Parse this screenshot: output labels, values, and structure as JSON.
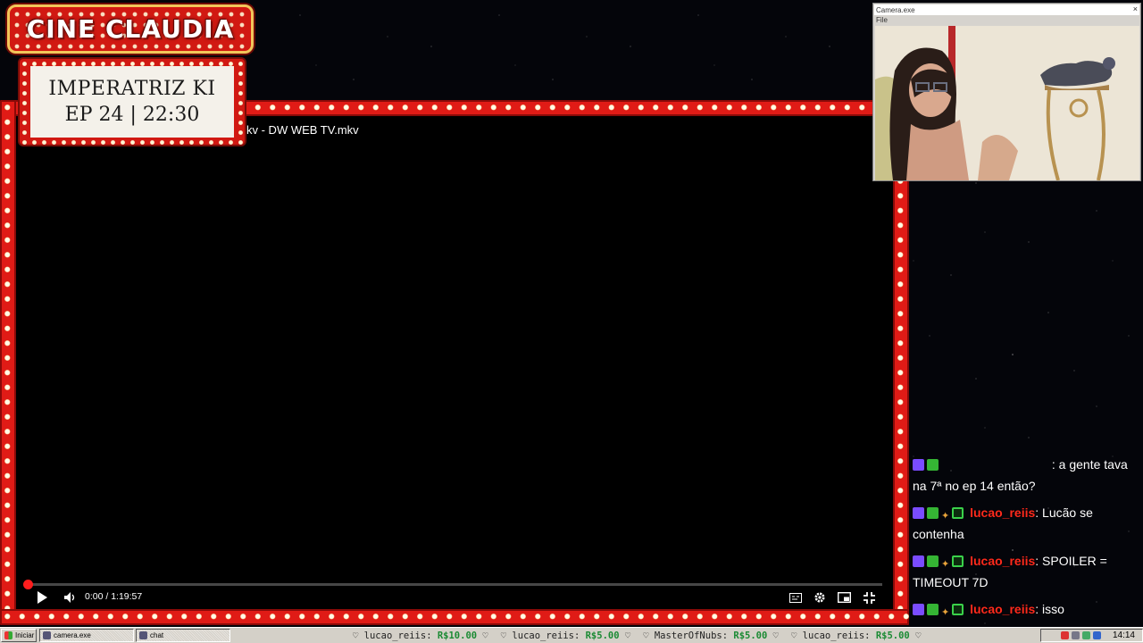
{
  "logo": {
    "text": "CINE CLAUDIA"
  },
  "sign": {
    "line1": "IMPERATRIZ KI",
    "line2": "EP 24 | 22:30"
  },
  "video": {
    "title": "kv - DW WEB TV.mkv",
    "time": "0:00 / 1:19:57",
    "progress": 0.0
  },
  "camera_window": {
    "title": "Camera.exe",
    "menu": "File",
    "close": "×"
  },
  "chat": [
    {
      "user": "",
      "text": ": a gente tava na 7ª no ep 14 então?"
    },
    {
      "user": "lucao_reiis",
      "text": ": Lucão se contenha"
    },
    {
      "user": "lucao_reiis",
      "text": ": SPOILER = TIMEOUT 7D"
    },
    {
      "user": "lucao_reiis",
      "text": ": isso"
    }
  ],
  "taskbar": {
    "start": "Iniciar",
    "buttons": [
      "camera.exe",
      "chat"
    ],
    "ticker": [
      {
        "user": "lucao_reiis:",
        "amount": "R$10.00"
      },
      {
        "user": "lucao_reiis:",
        "amount": "R$5.00"
      },
      {
        "user": "MasterOfNubs:",
        "amount": "R$5.00"
      },
      {
        "user": "lucao_reiis:",
        "amount": "R$5.00"
      }
    ],
    "clock": "14:14"
  },
  "colors": {
    "frame_red": "#e01b16",
    "username_red": "#ff2a1c",
    "donation_green": "#1a8a33"
  }
}
